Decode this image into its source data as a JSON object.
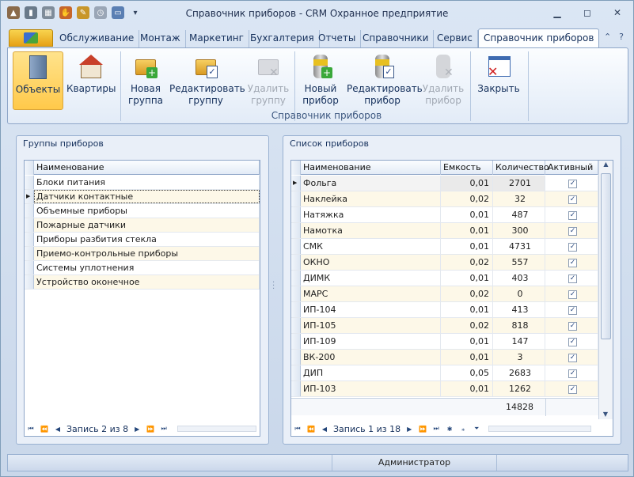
{
  "window": {
    "title": "Справочник приборов - CRM Охранное предприятие"
  },
  "tabs": [
    "Обслуживание",
    "Монтаж",
    "Маркетинг",
    "Бухгалтерия",
    "Отчеты",
    "Справочники",
    "Сервис",
    "Справочник приборов"
  ],
  "ribbon": {
    "buttons": [
      {
        "label1": "Объекты",
        "label2": "",
        "state": "selected"
      },
      {
        "label1": "Квартиры",
        "label2": "",
        "state": "normal"
      },
      {
        "label1": "Новая",
        "label2": "группа",
        "state": "normal"
      },
      {
        "label1": "Редактировать",
        "label2": "группу",
        "state": "normal"
      },
      {
        "label1": "Удалить",
        "label2": "группу",
        "state": "disabled"
      },
      {
        "label1": "Новый",
        "label2": "прибор",
        "state": "normal"
      },
      {
        "label1": "Редактировать",
        "label2": "прибор",
        "state": "normal"
      },
      {
        "label1": "Удалить",
        "label2": "прибор",
        "state": "disabled"
      },
      {
        "label1": "Закрыть",
        "label2": "",
        "state": "normal"
      }
    ],
    "group_label": "Справочник приборов"
  },
  "groups_panel": {
    "title": "Группы приборов",
    "column": "Наименование",
    "rows": [
      "Блоки питания",
      "Датчики контактные",
      "Объемные приборы",
      "Пожарные датчики",
      "Приборы разбития стекла",
      "Приемо-контрольные приборы",
      "Системы уплотнения",
      "Устройство оконечное"
    ],
    "nav_text": "Запись 2 из 8"
  },
  "devices_panel": {
    "title": "Список приборов",
    "columns": [
      "Наименование",
      "Емкость",
      "Количество",
      "Активный"
    ],
    "rows": [
      {
        "name": "Фольга",
        "cap": "0,01",
        "qty": "2701"
      },
      {
        "name": "Наклейка",
        "cap": "0,02",
        "qty": "32"
      },
      {
        "name": "Натяжка",
        "cap": "0,01",
        "qty": "487"
      },
      {
        "name": "Намотка",
        "cap": "0,01",
        "qty": "300"
      },
      {
        "name": "СМК",
        "cap": "0,01",
        "qty": "4731"
      },
      {
        "name": "ОКНО",
        "cap": "0,02",
        "qty": "557"
      },
      {
        "name": "ДИМК",
        "cap": "0,01",
        "qty": "403"
      },
      {
        "name": "МАРС",
        "cap": "0,02",
        "qty": "0"
      },
      {
        "name": "ИП-104",
        "cap": "0,01",
        "qty": "413"
      },
      {
        "name": "ИП-105",
        "cap": "0,02",
        "qty": "818"
      },
      {
        "name": "ИП-109",
        "cap": "0,01",
        "qty": "147"
      },
      {
        "name": "ВК-200",
        "cap": "0,01",
        "qty": "3"
      },
      {
        "name": "ДИП",
        "cap": "0,05",
        "qty": "2683"
      },
      {
        "name": "ИП-103",
        "cap": "0,01",
        "qty": "1262"
      }
    ],
    "total": "14828",
    "nav_text": "Запись 1 из 18"
  },
  "status": {
    "user": "Администратор"
  }
}
